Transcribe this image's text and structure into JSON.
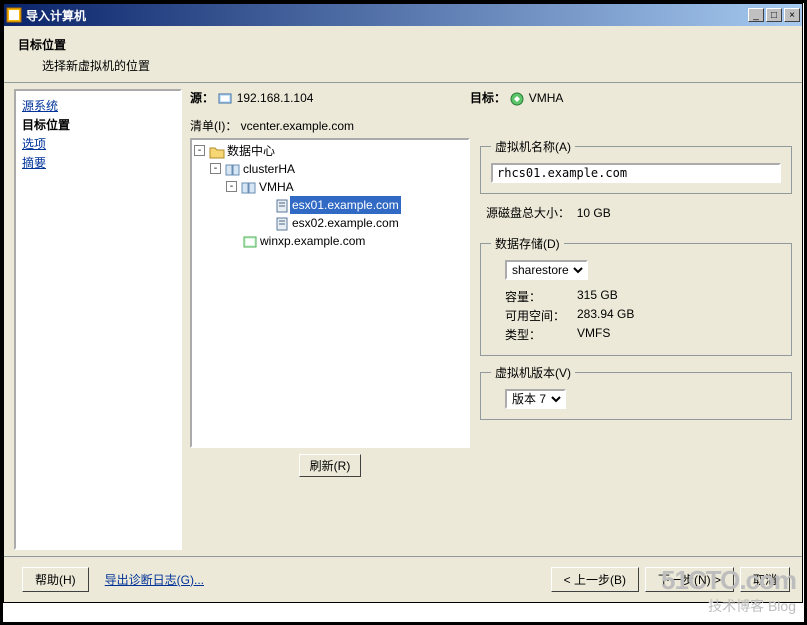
{
  "window": {
    "title": "导入计算机"
  },
  "header": {
    "title": "目标位置",
    "sub": "选择新虚拟机的位置"
  },
  "sidebar": {
    "items": [
      "源系统",
      "目标位置",
      "选项",
      "摘要"
    ],
    "active_index": 1
  },
  "info": {
    "src_label": "源：",
    "src_value": "192.168.1.104",
    "dst_label": "目标：",
    "dst_value": "VMHA",
    "list_label": "清单(I)：",
    "list_value": "vcenter.example.com"
  },
  "tree": {
    "root": "数据中心",
    "cluster": "clusterHA",
    "vmha": "VMHA",
    "items": [
      "esx01.example.com",
      "esx02.example.com",
      "winxp.example.com"
    ],
    "selected_index": 0
  },
  "vm_name": {
    "legend": "虚拟机名称(A)",
    "value": "rhcs01.example.com"
  },
  "src_disk": {
    "label": "源磁盘总大小：",
    "value": "10 GB"
  },
  "datastore": {
    "legend": "数据存储(D)",
    "selected": "sharestore",
    "capacity_label": "容量：",
    "capacity": "315 GB",
    "free_label": "可用空间：",
    "free": "283.94 GB",
    "type_label": "类型：",
    "type": "VMFS"
  },
  "vm_version": {
    "legend": "虚拟机版本(V)",
    "selected": "版本 7"
  },
  "buttons": {
    "refresh": "刷新(R)",
    "help": "帮助(H)",
    "diag": "导出诊断日志(G)...",
    "back": "< 上一步(B)",
    "next": "下一步(N) >",
    "cancel": "取消"
  },
  "watermark": {
    "big": "51CTO.com",
    "small": "技术博客 Blog"
  }
}
